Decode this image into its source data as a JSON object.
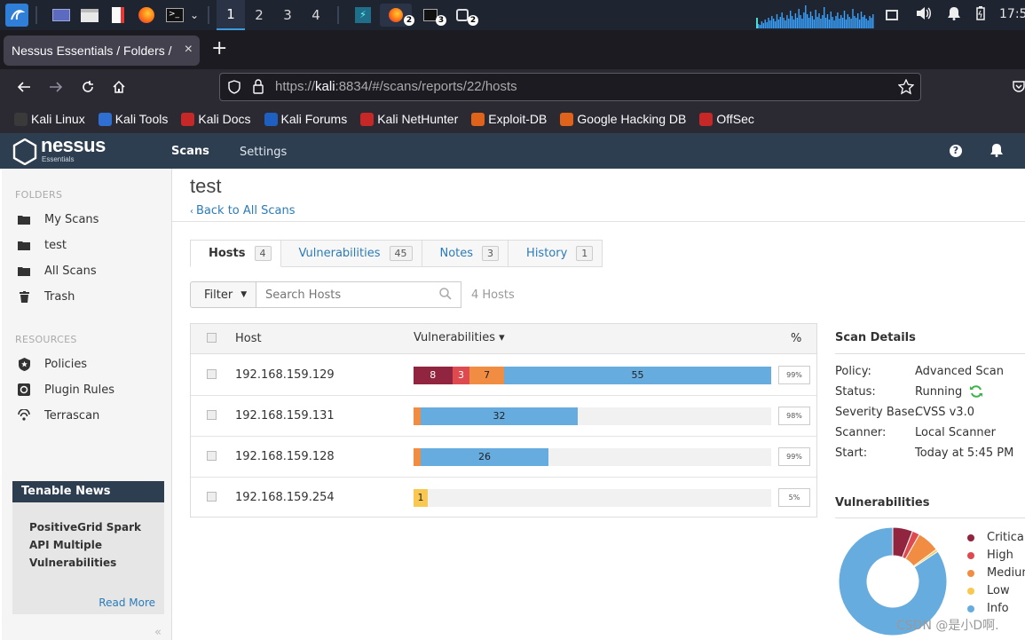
{
  "taskbar": {
    "workspaces": [
      "1",
      "2",
      "3",
      "4"
    ],
    "active_workspace": "1",
    "badges": [
      "2",
      "3",
      "2"
    ],
    "clock": "17:5"
  },
  "browser": {
    "tab_title": "Nessus Essentials / Folders / ",
    "tab_close": "×",
    "new_tab": "+",
    "url_prefix": "https://",
    "url_host": "kali",
    "url_rest": ":8834/#/scans/reports/22/hosts",
    "bookmarks": [
      {
        "label": "Kali Linux",
        "color": "#3a3a3a"
      },
      {
        "label": "Kali Tools",
        "color": "#2f6fd1"
      },
      {
        "label": "Kali Docs",
        "color": "#c62828"
      },
      {
        "label": "Kali Forums",
        "color": "#1f5fbf"
      },
      {
        "label": "Kali NetHunter",
        "color": "#c62828"
      },
      {
        "label": "Exploit-DB",
        "color": "#e0631b"
      },
      {
        "label": "Google Hacking DB",
        "color": "#e0631b"
      },
      {
        "label": "OffSec",
        "color": "#c62828"
      }
    ]
  },
  "nessus_header": {
    "logo_word": "nessus",
    "logo_sub": "Essentials",
    "nav_scans": "Scans",
    "nav_settings": "Settings",
    "help": "?"
  },
  "sidebar": {
    "folders_heading": "FOLDERS",
    "folders": [
      {
        "label": "My Scans",
        "icon": "folder-icon"
      },
      {
        "label": "test",
        "icon": "folder-icon"
      },
      {
        "label": "All Scans",
        "icon": "folder-icon"
      },
      {
        "label": "Trash",
        "icon": "trash-icon"
      }
    ],
    "resources_heading": "RESOURCES",
    "resources": [
      {
        "label": "Policies",
        "icon": "policy-icon"
      },
      {
        "label": "Plugin Rules",
        "icon": "plugin-icon"
      },
      {
        "label": "Terrascan",
        "icon": "terrascan-icon"
      }
    ],
    "news": {
      "heading": "Tenable News",
      "headline_1": "PositiveGrid Spark",
      "headline_2": "API Multiple",
      "headline_3": "Vulnerabilities",
      "read_more": "Read More"
    },
    "collapse": "«"
  },
  "main": {
    "title": "test",
    "back_link": "Back to All Scans",
    "tabs": [
      {
        "label": "Hosts",
        "count": "4",
        "active": true
      },
      {
        "label": "Vulnerabilities",
        "count": "45",
        "active": false
      },
      {
        "label": "Notes",
        "count": "3",
        "active": false
      },
      {
        "label": "History",
        "count": "1",
        "active": false
      }
    ],
    "filter_label": "Filter",
    "search_placeholder": "Search Hosts",
    "host_count": "4 Hosts",
    "columns": {
      "host": "Host",
      "vulnerabilities": "Vulnerabilities ▾",
      "percent": "%"
    },
    "hosts": [
      {
        "ip": "192.168.159.129",
        "critical": 8,
        "high": 3,
        "medium": 7,
        "low": 0,
        "info": 55,
        "percent": "99%"
      },
      {
        "ip": "192.168.159.131",
        "critical": 0,
        "high": 0,
        "medium": 1,
        "low": 0,
        "info": 32,
        "percent": "98%"
      },
      {
        "ip": "192.168.159.128",
        "critical": 0,
        "high": 0,
        "medium": 1,
        "low": 0,
        "info": 26,
        "percent": "99%"
      },
      {
        "ip": "192.168.159.254",
        "critical": 0,
        "high": 0,
        "medium": 0,
        "low": 1,
        "info": 0,
        "percent": "5%"
      }
    ]
  },
  "details": {
    "title": "Scan Details",
    "rows": [
      {
        "label": "Policy:",
        "value": "Advanced Scan"
      },
      {
        "label": "Status:",
        "value": "Running"
      },
      {
        "label": "Severity Base:",
        "value": "CVSS v3.0"
      },
      {
        "label": "Scanner:",
        "value": "Local Scanner"
      },
      {
        "label": "Start:",
        "value": "Today at 5:45 PM"
      }
    ],
    "vulns_title": "Vulnerabilities",
    "legend": [
      {
        "label": "Critical",
        "color": "#91243e"
      },
      {
        "label": "High",
        "color": "#dd4b50"
      },
      {
        "label": "Medium",
        "color": "#f18c43"
      },
      {
        "label": "Low",
        "color": "#f8c851"
      },
      {
        "label": "Info",
        "color": "#67acdf"
      }
    ],
    "donut_values": {
      "critical": 8,
      "high": 3,
      "medium": 9,
      "low": 1,
      "info": 113
    }
  },
  "watermark": "CSDN @是小D啊."
}
